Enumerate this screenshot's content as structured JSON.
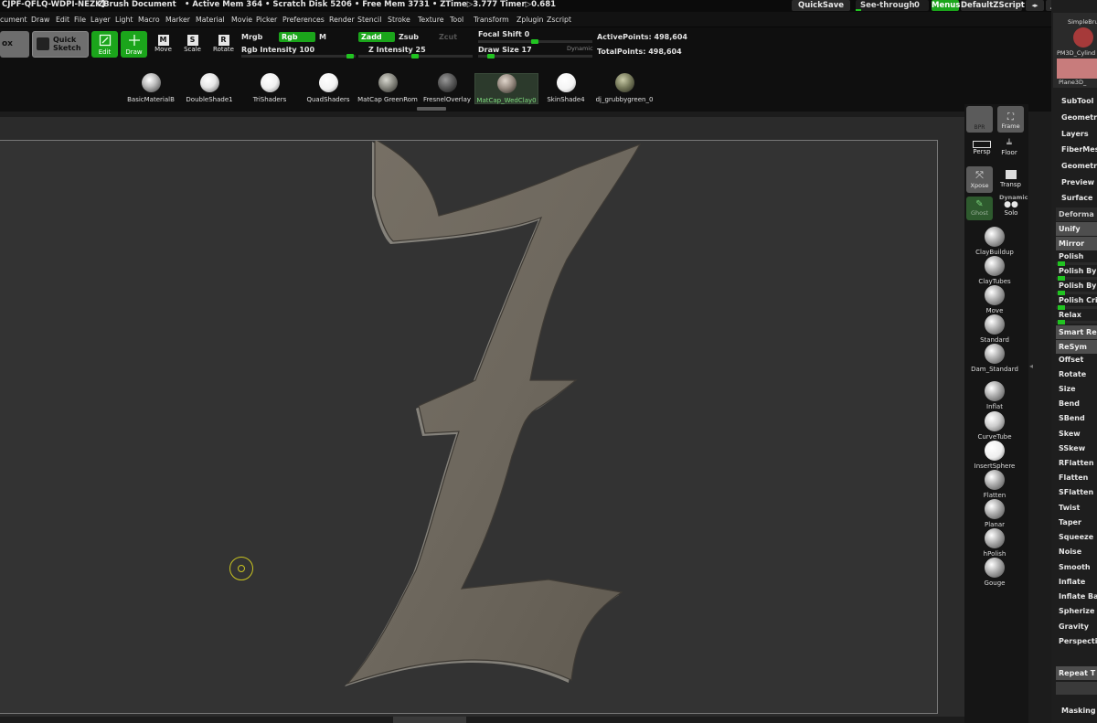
{
  "titlebar": {
    "id": "CJPF-QFLQ-WDPI-NEZK]",
    "doc": "ZBrush Document",
    "stats": "• Active Mem 364 • Scratch Disk 5206 • Free Mem 3731 • ZTime▷3.777 Timer▷0.681",
    "quicksave": "QuickSave",
    "seethrough": "See-through",
    "seethrough_val": "0",
    "menus": "Menus",
    "defaultzscript": "DefaultZScript"
  },
  "menubar": [
    "cument",
    "Draw",
    "Edit",
    "File",
    "Layer",
    "Light",
    "Macro",
    "Marker",
    "Material",
    "Movie",
    "Picker",
    "Preferences",
    "Render",
    "Stencil",
    "Stroke",
    "Texture",
    "Tool",
    "Transform",
    "Zplugin",
    "Zscript"
  ],
  "toolbar": {
    "ox": "ox",
    "quick_sketch_1": "Quick",
    "quick_sketch_2": "Sketch",
    "edit": "Edit",
    "draw": "Draw",
    "move": "Move",
    "scale": "Scale",
    "rotate": "Rotate",
    "mrgb": "Mrgb",
    "rgb": "Rgb",
    "m": "M",
    "rgb_intensity": "Rgb Intensity 100",
    "zadd": "Zadd",
    "zsub": "Zsub",
    "zcut": "Zcut",
    "z_intensity": "Z Intensity 25",
    "focal_shift": "Focal Shift 0",
    "draw_size": "Draw Size 17",
    "dynamic": "Dynamic",
    "active_points": "ActivePoints: 498,604",
    "total_points": "TotalPoints: 498,604"
  },
  "materials": [
    {
      "name": "BasicMaterialB",
      "color": "#bdbdbd"
    },
    {
      "name": "DoubleShade1",
      "color": "#e6e6e6"
    },
    {
      "name": "TriShaders",
      "color": "#f0f0f0"
    },
    {
      "name": "QuadShaders",
      "color": "#f2f2f2"
    },
    {
      "name": "MatCap GreenRom",
      "color": "#8a8a82"
    },
    {
      "name": "FresnelOverlay",
      "color": "#5a5a5a"
    },
    {
      "name": "MatCap_WedClay0",
      "color": "#9a8e84"
    },
    {
      "name": "SkinShade4",
      "color": "#f4f4f4"
    },
    {
      "name": "dj_grubbygreen_0",
      "color": "#7a7d5e"
    }
  ],
  "right_shelf": {
    "bpr": "BPR",
    "frame": "Frame",
    "persp": "Persp",
    "floor": "Floor",
    "xpose": "Xpose",
    "transp": "Transp",
    "dynamic": "Dynamic",
    "ghost": "Ghost",
    "solo": "Solo",
    "brushes": [
      "ClayBuildup",
      "ClayTubes",
      "Move",
      "Standard",
      "Dam_Standard",
      "Inflat",
      "CurveTube",
      "InsertSphere",
      "Flatten",
      "Planar",
      "hPolish",
      "Gouge"
    ]
  },
  "tray": {
    "simplebrush": "SimpleBru",
    "pm3d": "PM3D_Cylind",
    "plane3d": "Plane3D_",
    "subtool": "SubTool",
    "geometry": "Geometr",
    "layers": "Layers",
    "fibermesh": "FiberMes",
    "geometryhd": "Geometr",
    "preview": "Preview",
    "surface": "Surface",
    "deformation": "Deforma",
    "unify": "Unify",
    "mirror": "Mirror",
    "polish": "Polish",
    "polish_by1": "Polish By",
    "polish_by2": "Polish By",
    "polish_cri": "Polish Cri",
    "relax": "Relax",
    "smart_re": "Smart Re",
    "resym": "ReSym",
    "items": [
      "Offset",
      "Rotate",
      "Size",
      "Bend",
      "SBend",
      "Skew",
      "SSkew",
      "RFlatten",
      "Flatten",
      "SFlatten",
      "Twist",
      "Taper",
      "Squeeze",
      "Noise",
      "Smooth",
      "Inflate",
      "Inflate Ba",
      "Spherize",
      "Gravity",
      "Perspective"
    ],
    "repeat": "Repeat T",
    "masking": "Masking"
  },
  "colors": {
    "green": "#1ba51b",
    "dark_panel": "#0f0f0f",
    "canvas": "#333333"
  }
}
